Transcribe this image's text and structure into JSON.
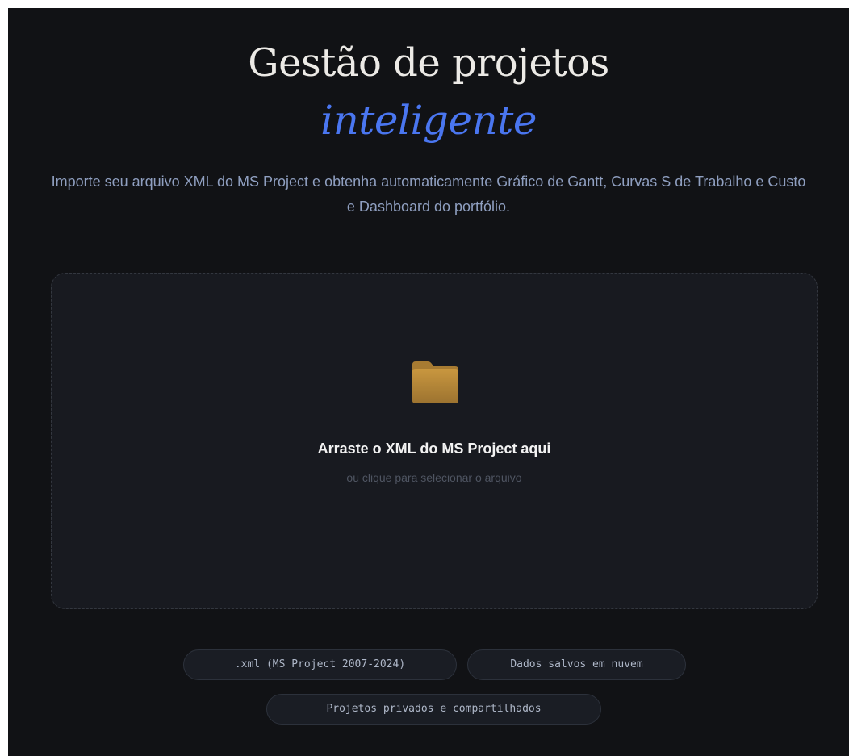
{
  "hero": {
    "title": "Gestão de projetos",
    "title_accent": "inteligente",
    "subtitle": "Importe seu arquivo XML do MS Project e obtenha automaticamente Gráfico de Gantt, Curvas S de Trabalho e Custo e Dashboard do portfólio."
  },
  "dropzone": {
    "icon": "folder-icon",
    "title": "Arraste o XML do MS Project aqui",
    "hint": "ou clique para selecionar o arquivo"
  },
  "chips": [
    ".xml (MS Project 2007-2024)",
    "Dados salvos em nuvem",
    "Projetos privados e compartilhados"
  ],
  "colors": {
    "background": "#111215",
    "accent": "#4a76f0",
    "folder": "#b88a3a"
  }
}
